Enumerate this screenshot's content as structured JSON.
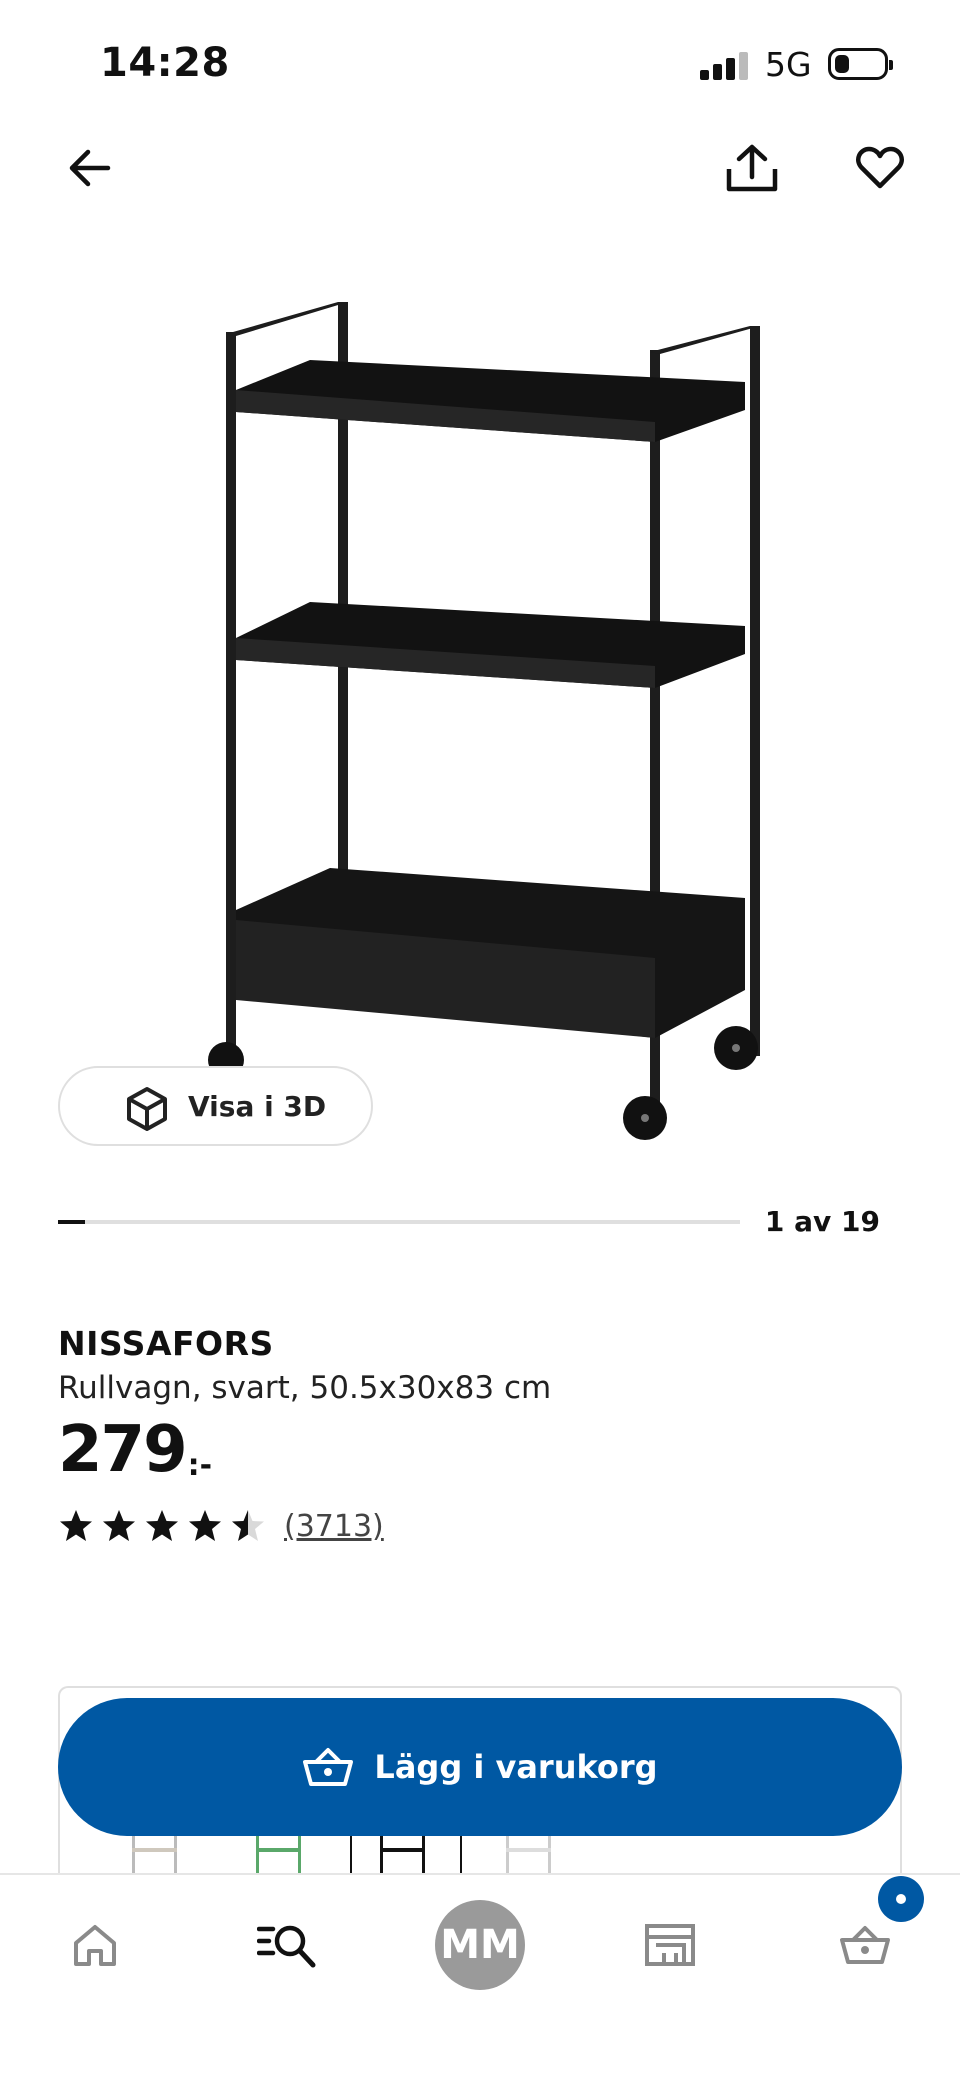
{
  "status_bar": {
    "time": "14:28",
    "network": "5G",
    "battery_level": 0.3
  },
  "nav": {
    "back_icon": "arrow-left-icon",
    "share_icon": "share-icon",
    "favorite_icon": "heart-icon"
  },
  "gallery": {
    "view_3d_label": "Visa i 3D",
    "position_label": "1 av 19",
    "progress": 0.04
  },
  "product": {
    "name": "NISSAFORS",
    "description": "Rullvagn, svart, 50.5x30x83 cm",
    "price_integer": "279",
    "price_suffix": ":-",
    "rating": 4.5,
    "rating_max": 5,
    "review_count": "(3713)"
  },
  "cart_action": {
    "label": "Lägg i varukorg",
    "icon": "basket-icon"
  },
  "tab_bar": {
    "items": [
      {
        "name": "home",
        "icon": "home-icon"
      },
      {
        "name": "search",
        "icon": "search-icon"
      },
      {
        "name": "profile",
        "initials": "MM"
      },
      {
        "name": "stores",
        "icon": "store-icon"
      },
      {
        "name": "cart",
        "icon": "basket-icon"
      }
    ]
  },
  "colors": {
    "brand_blue": "#0058a3",
    "text": "#111111",
    "avatar_gray": "#9a9a9a"
  }
}
